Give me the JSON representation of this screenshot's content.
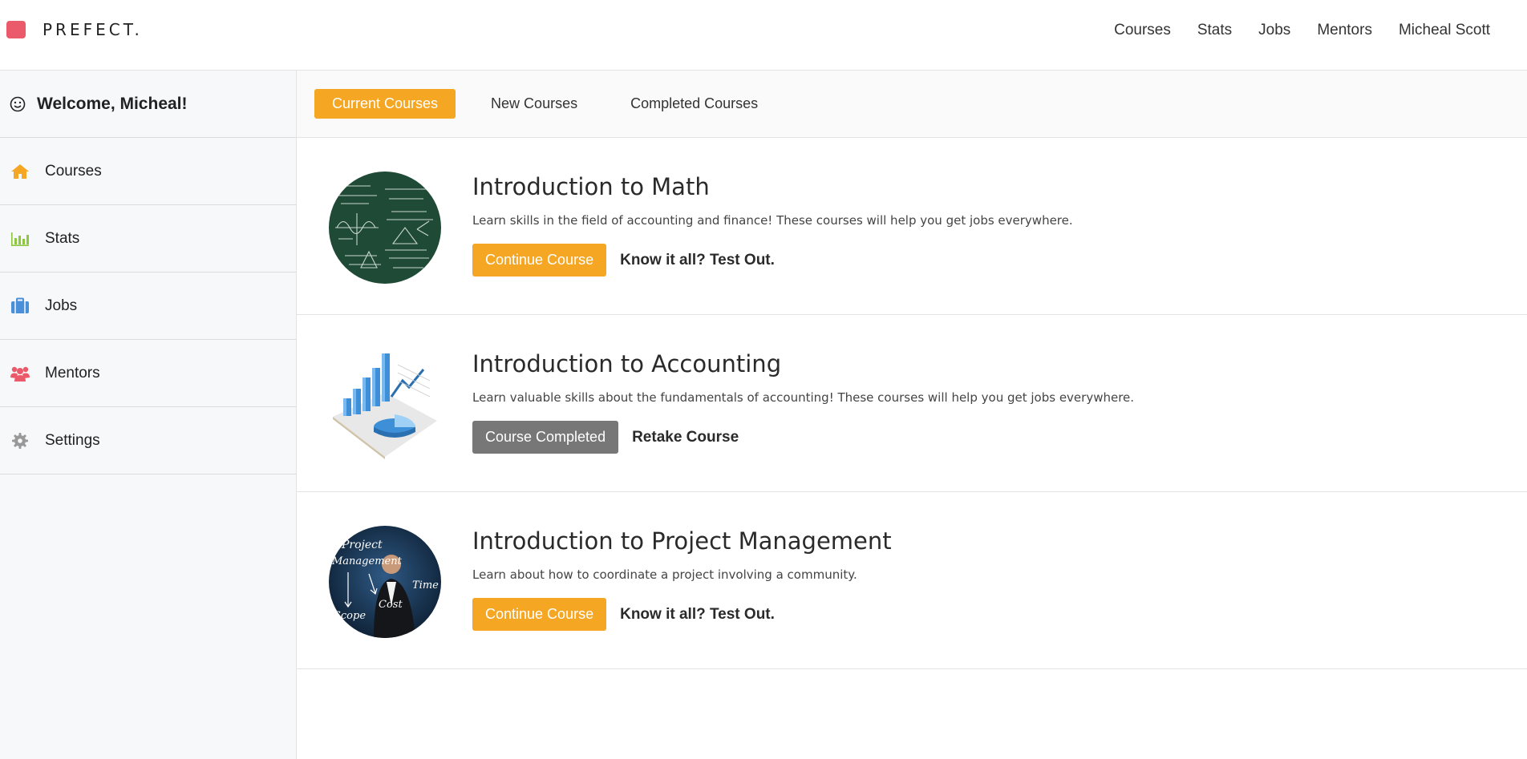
{
  "brand": {
    "name": "PREFECT.",
    "color": "#ea5a6a"
  },
  "topnav": [
    "Courses",
    "Stats",
    "Jobs",
    "Mentors",
    "Micheal Scott"
  ],
  "sidebar": {
    "welcome": "Welcome, Micheal!",
    "items": [
      {
        "label": "Courses",
        "icon": "home-icon",
        "color": "#f5a623"
      },
      {
        "label": "Stats",
        "icon": "bar-chart-icon",
        "color": "#8dc63f"
      },
      {
        "label": "Jobs",
        "icon": "briefcase-icon",
        "color": "#4a90d9"
      },
      {
        "label": "Mentors",
        "icon": "users-icon",
        "color": "#ea5a6a"
      },
      {
        "label": "Settings",
        "icon": "gear-icon",
        "color": "#999999"
      }
    ]
  },
  "tabs": {
    "current": "Current Courses",
    "new": "New Courses",
    "completed": "Completed Courses"
  },
  "courses": [
    {
      "title": "Introduction to Math",
      "description": "Learn skills in the field of accounting and finance! These courses will help you get jobs everywhere.",
      "primary": "Continue Course",
      "secondary": "Know it all? Test Out."
    },
    {
      "title": "Introduction to Accounting",
      "description": "Learn valuable skills about the fundamentals of accounting! These courses will help you get jobs everywhere.",
      "primary": "Course Completed",
      "secondary": "Retake Course"
    },
    {
      "title": "Introduction to Project Management",
      "description": "Learn about how to coordinate a project involving a community.",
      "primary": "Continue Course",
      "secondary": "Know it all? Test Out."
    }
  ],
  "thumb_words": [
    "Project",
    "Management",
    "Time",
    "Cost",
    "Scope"
  ],
  "colors": {
    "accent": "#f5a623",
    "completed": "#777777"
  }
}
